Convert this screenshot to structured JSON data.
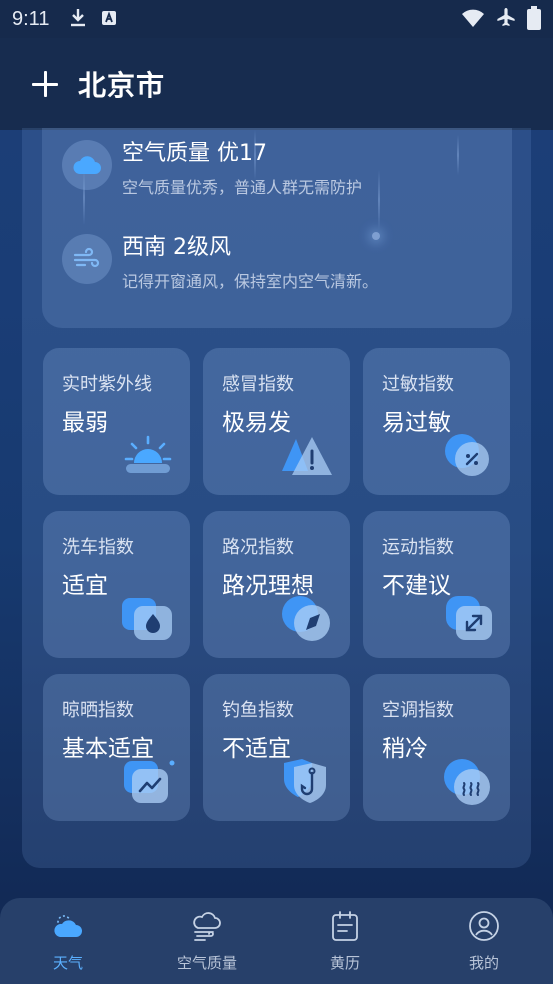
{
  "status_bar": {
    "time": "9:11",
    "left_icons": [
      "download-icon",
      "app-icon"
    ],
    "right_icons": [
      "wifi-icon",
      "airplane-icon",
      "battery-icon"
    ]
  },
  "header": {
    "add_icon": "plus-icon",
    "city": "北京市"
  },
  "info": [
    {
      "icon": "cloud-icon",
      "title": "空气质量  优17",
      "desc": "空气质量优秀，普通人群无需防护"
    },
    {
      "icon": "wind-icon",
      "title": "西南  2级风",
      "desc": "记得开窗通风，保持室内空气清新。"
    }
  ],
  "indices": [
    {
      "label": "实时紫外线",
      "value": "最弱",
      "icon": "sunrise-icon"
    },
    {
      "label": "感冒指数",
      "value": "极易发",
      "icon": "warning-icon"
    },
    {
      "label": "过敏指数",
      "value": "易过敏",
      "icon": "allergy-badge-icon"
    },
    {
      "label": "洗车指数",
      "value": "适宜",
      "icon": "water-drop-icon"
    },
    {
      "label": "路况指数",
      "value": "路况理想",
      "icon": "compass-icon"
    },
    {
      "label": "运动指数",
      "value": "不建议",
      "icon": "sport-arrow-icon"
    },
    {
      "label": "晾晒指数",
      "value": "基本适宜",
      "icon": "trend-icon"
    },
    {
      "label": "钓鱼指数",
      "value": "不适宜",
      "icon": "fishing-hook-icon"
    },
    {
      "label": "空调指数",
      "value": "稍冷",
      "icon": "air-conditioner-icon"
    }
  ],
  "tabs": [
    {
      "label": "天气",
      "icon": "weather-cloud-icon",
      "active": true
    },
    {
      "label": "空气质量",
      "icon": "air-quality-icon",
      "active": false
    },
    {
      "label": "黄历",
      "icon": "calendar-icon",
      "active": false
    },
    {
      "label": "我的",
      "icon": "profile-icon",
      "active": false
    }
  ],
  "colors": {
    "accent": "#5bb0ff",
    "background": "#1a3d76",
    "icon_blue": "#4aa8ff"
  }
}
